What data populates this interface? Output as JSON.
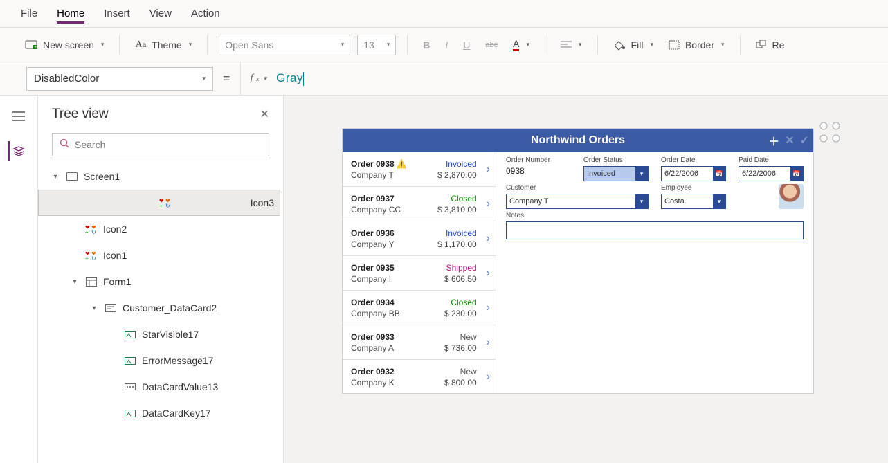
{
  "menu": {
    "file": "File",
    "home": "Home",
    "insert": "Insert",
    "view": "View",
    "action": "Action"
  },
  "ribbon": {
    "new_screen": "New screen",
    "theme": "Theme",
    "font": "Open Sans",
    "size": "13",
    "fill": "Fill",
    "border": "Border",
    "reorder": "Re"
  },
  "property_selector": "DisabledColor",
  "formula_value": "Gray",
  "panel": {
    "title": "Tree view",
    "search_placeholder": "Search"
  },
  "tree": [
    {
      "indent": 0,
      "toggle": "▾",
      "icon": "screen",
      "label": "Screen1",
      "sel": false
    },
    {
      "indent": 1,
      "toggle": "",
      "icon": "glyph",
      "label": "Icon3",
      "sel": true
    },
    {
      "indent": 1,
      "toggle": "",
      "icon": "glyph",
      "label": "Icon2",
      "sel": false
    },
    {
      "indent": 1,
      "toggle": "",
      "icon": "glyph",
      "label": "Icon1",
      "sel": false
    },
    {
      "indent": 1,
      "toggle": "▾",
      "icon": "form",
      "label": "Form1",
      "sel": false
    },
    {
      "indent": 2,
      "toggle": "▾",
      "icon": "card",
      "label": "Customer_DataCard2",
      "sel": false
    },
    {
      "indent": 3,
      "toggle": "",
      "icon": "ctrl",
      "label": "StarVisible17",
      "sel": false
    },
    {
      "indent": 3,
      "toggle": "",
      "icon": "ctrl",
      "label": "ErrorMessage17",
      "sel": false
    },
    {
      "indent": 3,
      "toggle": "",
      "icon": "input",
      "label": "DataCardValue13",
      "sel": false
    },
    {
      "indent": 3,
      "toggle": "",
      "icon": "ctrl",
      "label": "DataCardKey17",
      "sel": false
    }
  ],
  "app": {
    "title": "Northwind Orders",
    "orders": [
      {
        "id": "Order 0938",
        "warn": true,
        "company": "Company T",
        "status": "Invoiced",
        "amount": "$ 2,870.00"
      },
      {
        "id": "Order 0937",
        "warn": false,
        "company": "Company CC",
        "status": "Closed",
        "amount": "$ 3,810.00"
      },
      {
        "id": "Order 0936",
        "warn": false,
        "company": "Company Y",
        "status": "Invoiced",
        "amount": "$ 1,170.00"
      },
      {
        "id": "Order 0935",
        "warn": false,
        "company": "Company I",
        "status": "Shipped",
        "amount": "$ 606.50"
      },
      {
        "id": "Order 0934",
        "warn": false,
        "company": "Company BB",
        "status": "Closed",
        "amount": "$ 230.00"
      },
      {
        "id": "Order 0933",
        "warn": false,
        "company": "Company A",
        "status": "New",
        "amount": "$ 736.00"
      },
      {
        "id": "Order 0932",
        "warn": false,
        "company": "Company K",
        "status": "New",
        "amount": "$ 800.00"
      }
    ],
    "detail": {
      "order_number_label": "Order Number",
      "order_number": "0938",
      "order_status_label": "Order Status",
      "order_status": "Invoiced",
      "order_date_label": "Order Date",
      "order_date": "6/22/2006",
      "paid_date_label": "Paid Date",
      "paid_date": "6/22/2006",
      "customer_label": "Customer",
      "customer": "Company T",
      "employee_label": "Employee",
      "employee": "Costa",
      "notes_label": "Notes"
    }
  }
}
